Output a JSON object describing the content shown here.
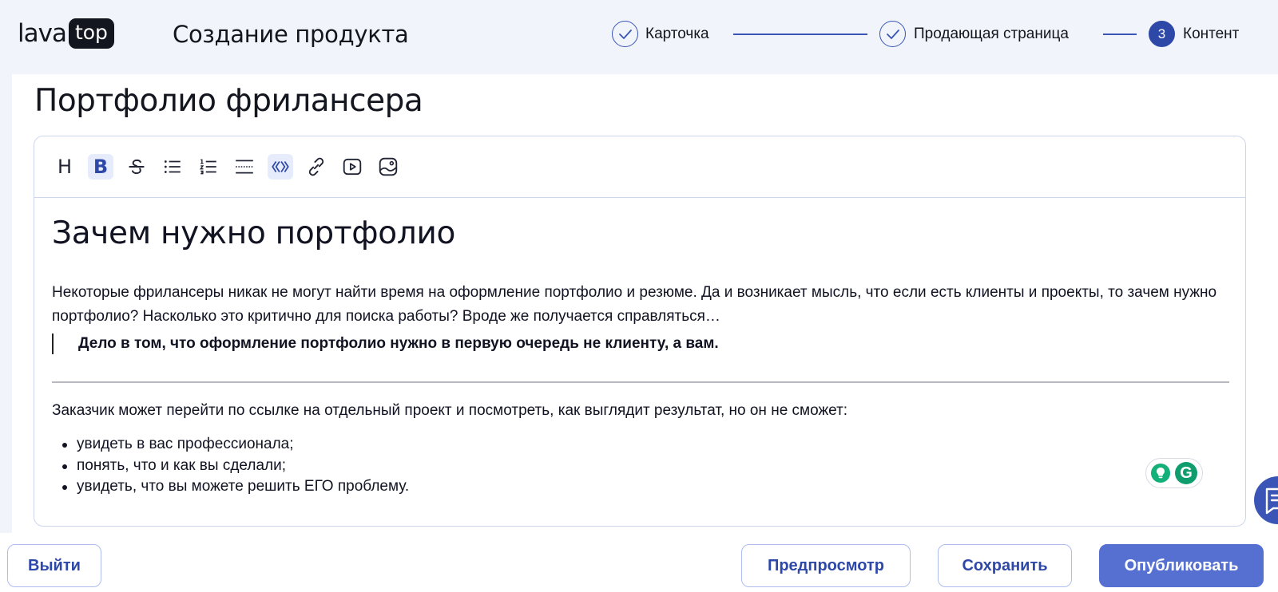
{
  "header": {
    "logo_left": "lava",
    "logo_right": "top",
    "title": "Создание продукта"
  },
  "steps": [
    {
      "label": "Карточка",
      "status": "done"
    },
    {
      "label": "Продающая страница",
      "status": "done"
    },
    {
      "label": "Контент",
      "status": "active",
      "number": "3"
    }
  ],
  "editor": {
    "doc_title": "Портфолио фрилансера",
    "toolbar": [
      {
        "name": "heading",
        "icon": "heading-icon",
        "glyph": "H",
        "active": false
      },
      {
        "name": "bold",
        "icon": "bold-icon",
        "glyph": "B",
        "active": true
      },
      {
        "name": "strike",
        "icon": "strikethrough-icon",
        "active": false
      },
      {
        "name": "bullet-list",
        "icon": "bullet-list-icon",
        "active": false
      },
      {
        "name": "ordered-list",
        "icon": "ordered-list-icon",
        "active": false
      },
      {
        "name": "divider",
        "icon": "horizontal-rule-icon",
        "active": false
      },
      {
        "name": "quote",
        "icon": "quote-icon",
        "active": true
      },
      {
        "name": "link",
        "icon": "link-icon",
        "active": false
      },
      {
        "name": "video",
        "icon": "video-icon",
        "active": false
      },
      {
        "name": "image",
        "icon": "image-icon",
        "active": false
      }
    ],
    "content": {
      "heading": "Зачем нужно портфолио",
      "paragraph": "Некоторые фрилансеры никак не могут найти время на оформление портфолио и резюме. Да и возникает мысль, что если есть клиенты и проекты, то зачем нужно портфолио? Насколько это критично для поиска работы? Вроде же получается справляться…",
      "quote": "Дело в том, что оформление портфолио нужно в первую очередь не клиенту, а вам.",
      "paragraph2": "Заказчик может перейти по ссылке на отдельный проект и посмотреть, как выглядит результат, но он не сможет:",
      "list": [
        "увидеть в вас профессионала;",
        "понять, что и как вы сделали;",
        "увидеть, что вы можете решить ЕГО проблему."
      ]
    },
    "grammarly_letter": "G"
  },
  "footer": {
    "exit": "Выйти",
    "preview": "Предпросмотр",
    "save": "Сохранить",
    "publish": "Опубликовать"
  },
  "colors": {
    "accent": "#2e48a8",
    "primary_button": "#5670d2",
    "background": "#f1f4fb",
    "border": "#cdd6ec"
  }
}
